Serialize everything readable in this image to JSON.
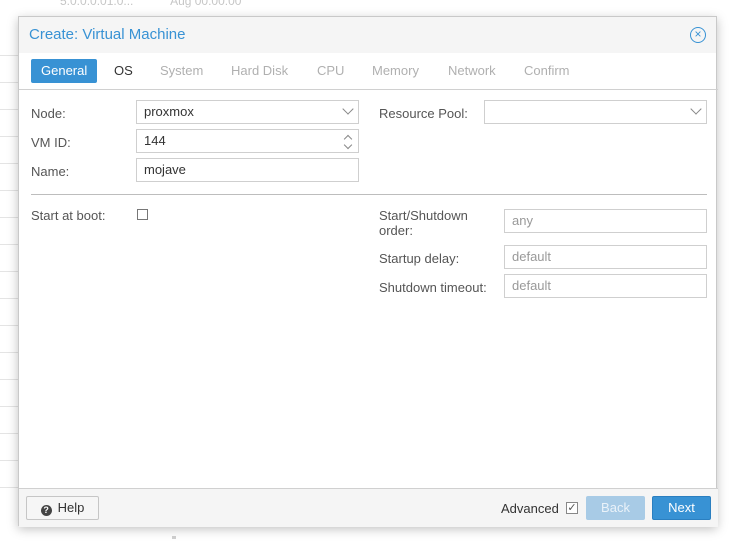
{
  "background": {
    "top_text": [
      "5.0.0.0.01.0...",
      "Aug 00:00:00"
    ]
  },
  "dialog": {
    "title": "Create: Virtual Machine",
    "close_icon": "×",
    "tabs": [
      {
        "label": "General",
        "state": "active"
      },
      {
        "label": "OS",
        "state": "enabled"
      },
      {
        "label": "System",
        "state": "disabled"
      },
      {
        "label": "Hard Disk",
        "state": "disabled"
      },
      {
        "label": "CPU",
        "state": "disabled"
      },
      {
        "label": "Memory",
        "state": "disabled"
      },
      {
        "label": "Network",
        "state": "disabled"
      },
      {
        "label": "Confirm",
        "state": "disabled"
      }
    ],
    "form": {
      "node": {
        "label": "Node:",
        "value": "proxmox"
      },
      "vmid": {
        "label": "VM ID:",
        "value": "144"
      },
      "name": {
        "label": "Name:",
        "value": "mojave"
      },
      "resource_pool": {
        "label": "Resource Pool:",
        "value": ""
      },
      "start_at_boot": {
        "label": "Start at boot:",
        "checked": false
      },
      "start_shutdown_order": {
        "label_line1": "Start/Shutdown",
        "label_line2": "order:",
        "placeholder": "any"
      },
      "startup_delay": {
        "label": "Startup delay:",
        "placeholder": "default"
      },
      "shutdown_timeout": {
        "label": "Shutdown timeout:",
        "placeholder": "default"
      }
    },
    "footer": {
      "help_label": "Help",
      "help_icon": "?",
      "advanced_label": "Advanced",
      "advanced_checked": true,
      "advanced_check_glyph": "✓",
      "back_label": "Back",
      "next_label": "Next"
    }
  },
  "colors": {
    "accent": "#3892d4",
    "disabled_button": "#a8cbe6"
  }
}
